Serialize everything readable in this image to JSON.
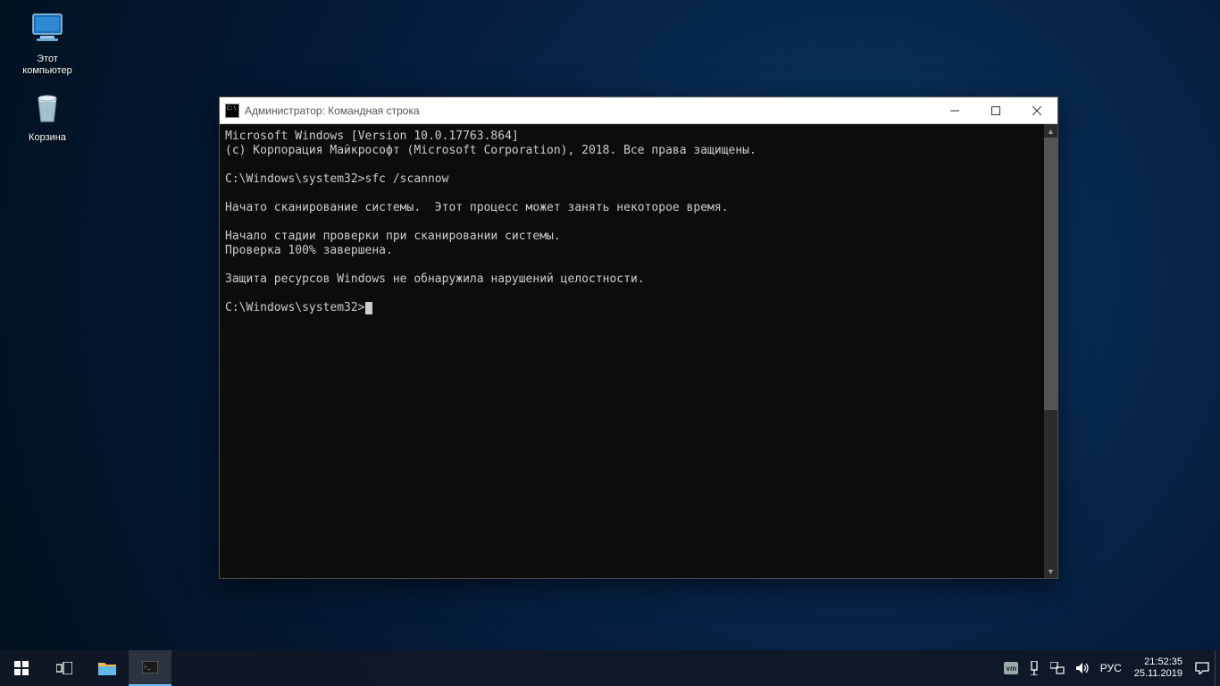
{
  "desktop": {
    "icons": [
      {
        "name": "this-pc",
        "label": "Этот\nкомпьютер"
      },
      {
        "name": "recycle-bin",
        "label": "Корзина"
      }
    ]
  },
  "window": {
    "title": "Администратор: Командная строка",
    "console_lines": [
      "Microsoft Windows [Version 10.0.17763.864]",
      "(c) Корпорация Майкрософт (Microsoft Corporation), 2018. Все права защищены.",
      "",
      "C:\\Windows\\system32>sfc /scannow",
      "",
      "Начато сканирование системы.  Этот процесс может занять некоторое время.",
      "",
      "Начало стадии проверки при сканировании системы.",
      "Проверка 100% завершена.",
      "",
      "Защита ресурсов Windows не обнаружила нарушений целостности.",
      "",
      "C:\\Windows\\system32>"
    ]
  },
  "taskbar": {
    "lang": "РУС",
    "time": "21:52:35",
    "date": "25.11.2019"
  }
}
